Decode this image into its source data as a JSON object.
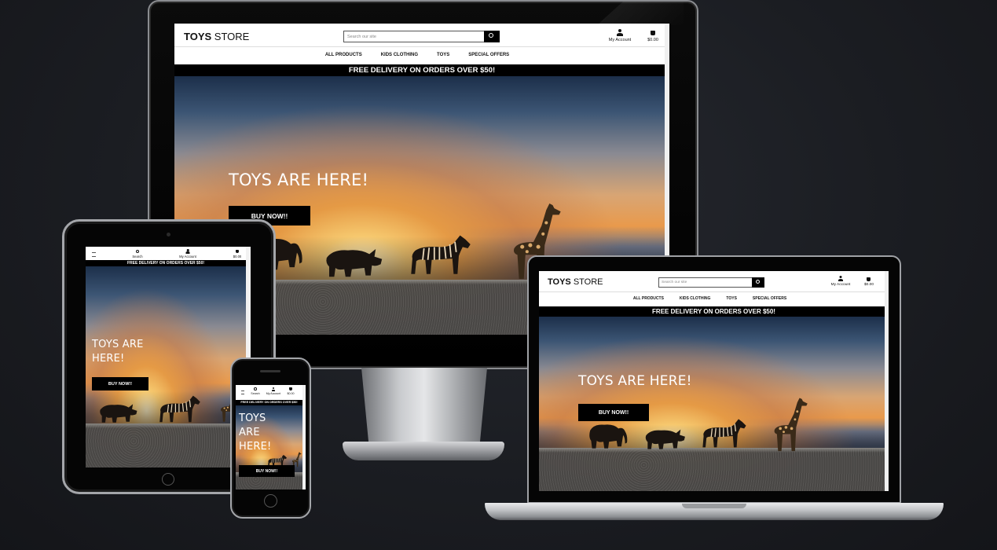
{
  "desktop": {
    "logo_bold": "TOYS",
    "logo_rest": " STORE",
    "search_placeholder": "Search our site",
    "account_label": "My Account",
    "cart_total": "$0.00",
    "nav": [
      "ALL PRODUCTS",
      "KIDS CLOTHING",
      "TOYS",
      "SPECIAL OFFERS"
    ],
    "banner": "FREE DELIVERY ON ORDERS OVER $50!",
    "hero_title": "TOYS ARE HERE!",
    "cta": "BUY NOW!!"
  },
  "laptop": {
    "logo_bold": "TOYS",
    "logo_rest": " STORE",
    "search_placeholder": "Search our site",
    "account_label": "My Account",
    "cart_total": "$0.00",
    "nav": [
      "ALL PRODUCTS",
      "KIDS CLOTHING",
      "TOYS",
      "SPECIAL OFFERS"
    ],
    "banner": "FREE DELIVERY ON ORDERS OVER $50!",
    "hero_title": "TOYS ARE HERE!",
    "cta": "BUY NOW!!"
  },
  "tablet": {
    "search_label": "Search",
    "account_label": "My Account",
    "cart_total": "$0.00",
    "banner": "FREE DELIVERY ON ORDERS OVER $50!",
    "hero_title_1": "TOYS ARE",
    "hero_title_2": "HERE!",
    "cta": "BUY NOW!!"
  },
  "phone": {
    "search_label": "Search",
    "account_label": "My Account",
    "cart_total": "$0.00",
    "banner": "FREE DELIVERY ON ORDERS OVER $50!",
    "hero_title_1": "TOYS",
    "hero_title_2": "ARE",
    "hero_title_3": "HERE!",
    "cta": "BUY NOW!!"
  },
  "icons": [
    "search-icon",
    "user-icon",
    "shopping-bag-icon",
    "menu-icon"
  ],
  "colors": {
    "background": "#1b1d22",
    "header_bg": "#ffffff",
    "banner_bg": "#000000",
    "button_bg": "#000000",
    "text_dark": "#111111",
    "hero_text": "#ffffff"
  }
}
